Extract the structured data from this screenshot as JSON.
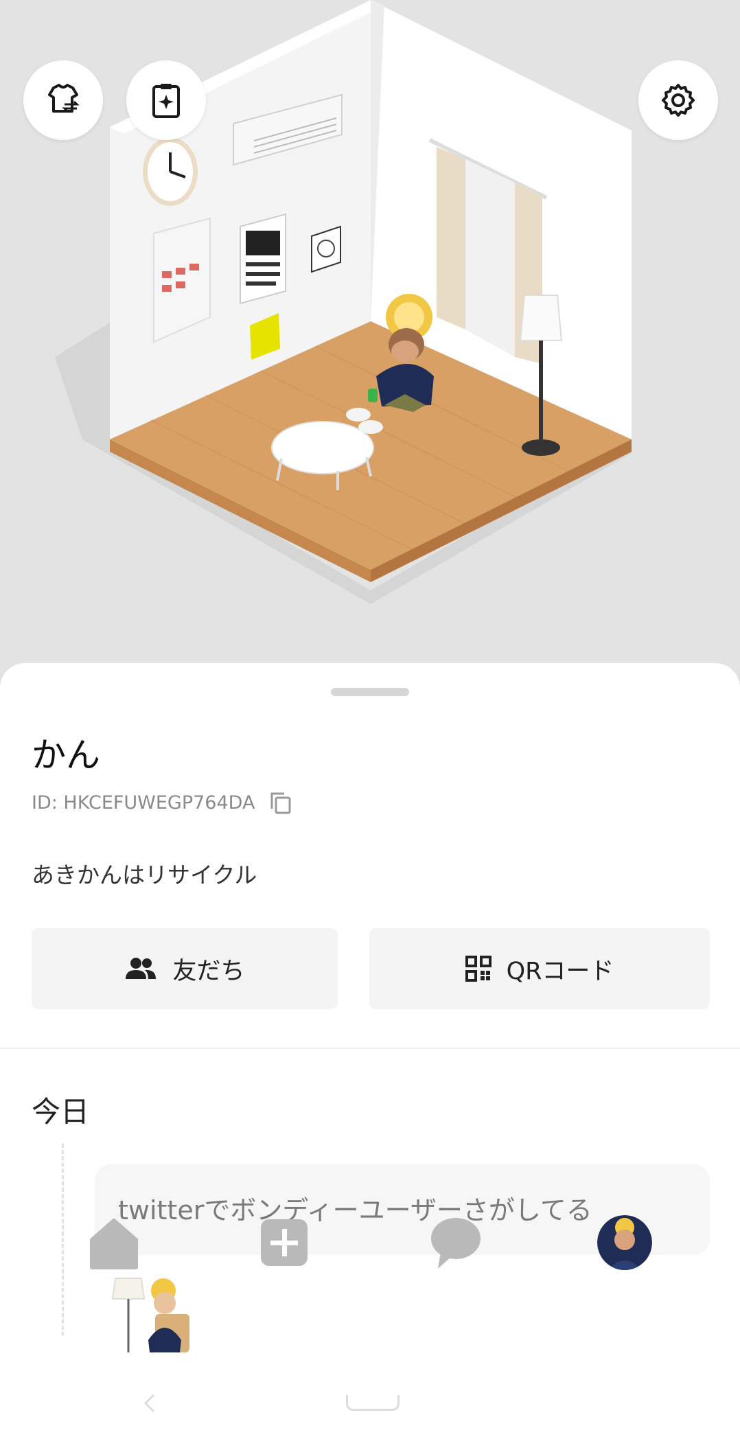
{
  "scene": {
    "buttons": {
      "outfit_icon": "shirt-swap-icon",
      "daily_icon": "clipboard-sparkle-icon",
      "settings_icon": "gear-icon"
    },
    "colors": {
      "floor": "#d9a066",
      "wall": "#ffffff",
      "background": "#e3e3e3"
    }
  },
  "profile": {
    "name": "かん",
    "id_text": "ID: HKCEFUWEGP764DA",
    "status_message": "あきかんはリサイクル",
    "friends_label": "友だち",
    "qr_label": "QRコード"
  },
  "timeline": {
    "heading": "今日",
    "post_text": "twitterでボンディーユーザーさがしてる"
  },
  "tabbar": {
    "home_icon": "home-icon",
    "add_icon": "plus-square-icon",
    "chat_icon": "speech-bubble-icon",
    "profile_icon": "avatar"
  },
  "system_nav": {
    "back_glyph": "‹"
  }
}
